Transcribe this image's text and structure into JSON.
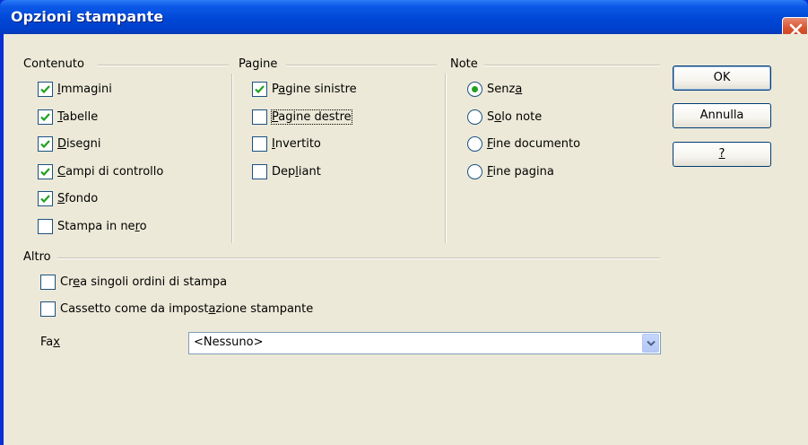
{
  "window": {
    "title": "Opzioni stampante"
  },
  "groups": {
    "contenuto": "Contenuto",
    "pagine": "Pagine",
    "note": "Note",
    "altro": "Altro"
  },
  "contenuto": [
    {
      "pre": "",
      "u": "I",
      "post": "mmagini",
      "checked": true
    },
    {
      "pre": "",
      "u": "T",
      "post": "abelle",
      "checked": true
    },
    {
      "pre": "",
      "u": "D",
      "post": "isegni",
      "checked": true
    },
    {
      "pre": "",
      "u": "C",
      "post": "ampi di controllo",
      "checked": true
    },
    {
      "pre": "",
      "u": "S",
      "post": "fondo",
      "checked": true
    },
    {
      "pre": "Stampa in ne",
      "u": "r",
      "post": "o",
      "checked": false
    }
  ],
  "pagine": [
    {
      "pre": "P",
      "u": "a",
      "post": "gine sinistre",
      "checked": true
    },
    {
      "pre": "",
      "u": "P",
      "post": "agine destre",
      "checked": false
    },
    {
      "pre": "",
      "u": "I",
      "post": "nvertito",
      "checked": false
    },
    {
      "pre": "Dep",
      "u": "l",
      "post": "iant",
      "checked": false
    }
  ],
  "note": [
    {
      "pre": "Senz",
      "u": "a",
      "post": "",
      "selected": true
    },
    {
      "pre": "S",
      "u": "o",
      "post": "lo note",
      "selected": false
    },
    {
      "pre": "",
      "u": "F",
      "post": "ine documento",
      "selected": false
    },
    {
      "pre": "",
      "u": "F",
      "post": "ine pagina",
      "selected": false
    }
  ],
  "altro": [
    {
      "pre": "Cr",
      "u": "e",
      "post": "a singoli ordini di stampa",
      "checked": false
    },
    {
      "pre": "Cassetto come da  impost",
      "u": "a",
      "post": "zione stampante",
      "checked": false
    }
  ],
  "fax": {
    "label_pre": "Fa",
    "label_u": "x",
    "value": "<Nessuno>"
  },
  "buttons": {
    "ok": "OK",
    "cancel": "Annulla",
    "help": "?"
  },
  "colors": {
    "titlebar": "#0047d6",
    "client": "#ece9d8",
    "check": "#21a121",
    "close": "#d8532f"
  }
}
